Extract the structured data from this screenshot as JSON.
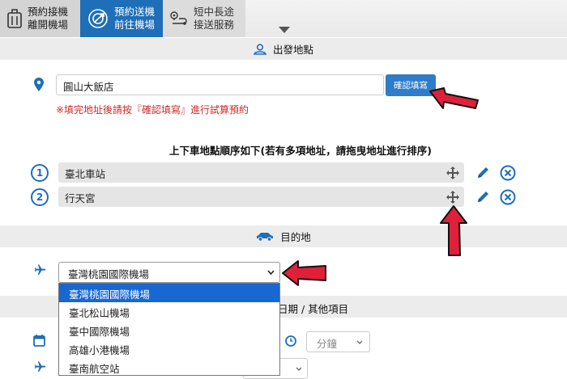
{
  "tabs": [
    {
      "label": "預約接機\n離開機場",
      "icon": "luggage-icon"
    },
    {
      "label": "預約送機\n前往機場",
      "icon": "target-icon"
    },
    {
      "label": "短中長途\n接送服務",
      "icon": "route-icon"
    }
  ],
  "departure": {
    "header": "出發地點",
    "address_value": "圓山大飯店",
    "confirm_label": "確認填寫",
    "warning": "※填完地址後請按『確認填寫』進行試算預約",
    "order_title": "上下車地點順序如下(若有多項地址，請拖曳地址進行排序)",
    "stops": [
      {
        "number": "1",
        "name": "臺北車站"
      },
      {
        "number": "2",
        "name": "行天宮"
      }
    ]
  },
  "destination": {
    "header": "目的地",
    "selected": "臺灣桃園國際機場",
    "options": [
      "臺灣桃園國際機場",
      "臺北松山機場",
      "臺中國際機場",
      "高雄小港機場",
      "臺南航空站"
    ]
  },
  "date_section": {
    "header_partial": "日期 / 其他項目",
    "minute_placeholder": "分鐘"
  },
  "colors": {
    "accent": "#1e6eb8",
    "arrow": "#e0203a",
    "warning": "#d02727"
  }
}
